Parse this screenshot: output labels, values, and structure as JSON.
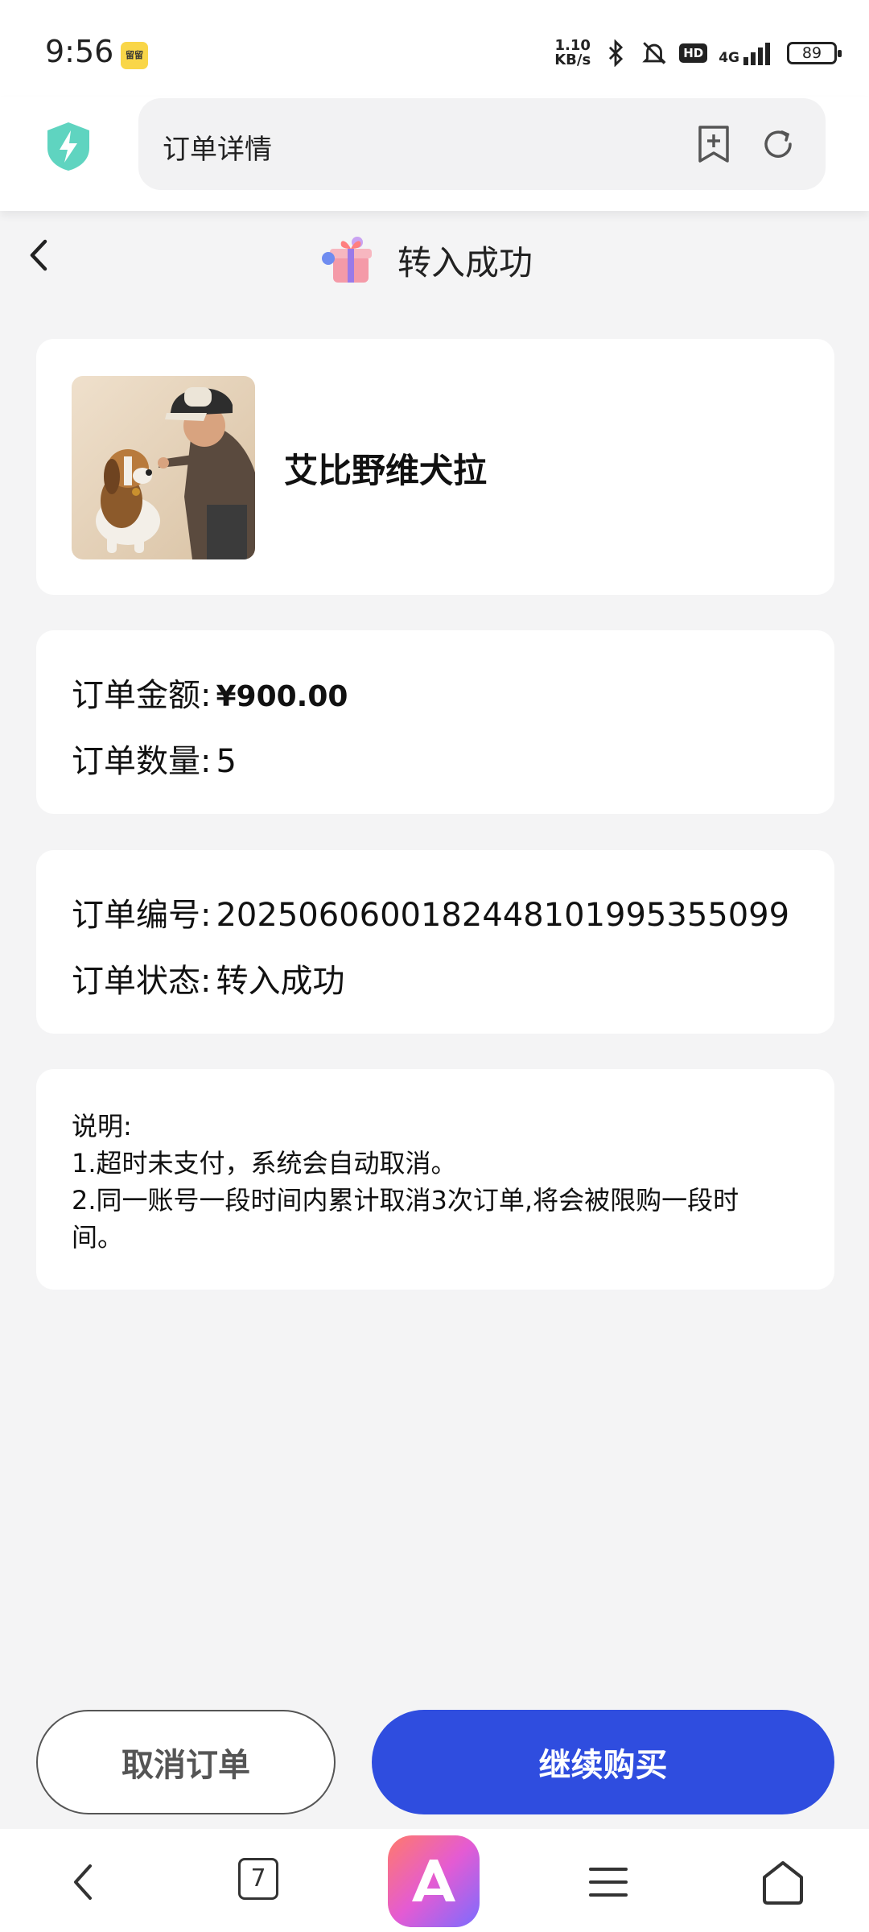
{
  "status_bar": {
    "time": "9:56",
    "app_icon_text": "留留",
    "net_speed_value": "1.10",
    "net_speed_unit": "KB/s",
    "hd": "HD",
    "network": "4G",
    "battery": "89"
  },
  "browser": {
    "address_text": "订单详情",
    "tab_count": "7"
  },
  "header": {
    "title": "转入成功"
  },
  "product": {
    "name": "艾比野维犬拉"
  },
  "amount_card": {
    "amount_label": "订单金额:",
    "amount_value": "¥900.00",
    "quantity_label": "订单数量:",
    "quantity_value": "5"
  },
  "order_card": {
    "number_label": "订单编号:",
    "number_value": "2025060600182448101995355099",
    "status_label": "订单状态:",
    "status_value": "转入成功"
  },
  "note": {
    "title": "说明:",
    "line1": "1.超时未支付，系统会自动取消。",
    "line2": "2.同一账号一段时间内累计取消3次订单,将会被限购一段时",
    "line3": "间。"
  },
  "buttons": {
    "cancel": "取消订单",
    "continue": "继续购买"
  },
  "colors": {
    "primary": "#2f4ddf",
    "background": "#f4f4f5"
  }
}
